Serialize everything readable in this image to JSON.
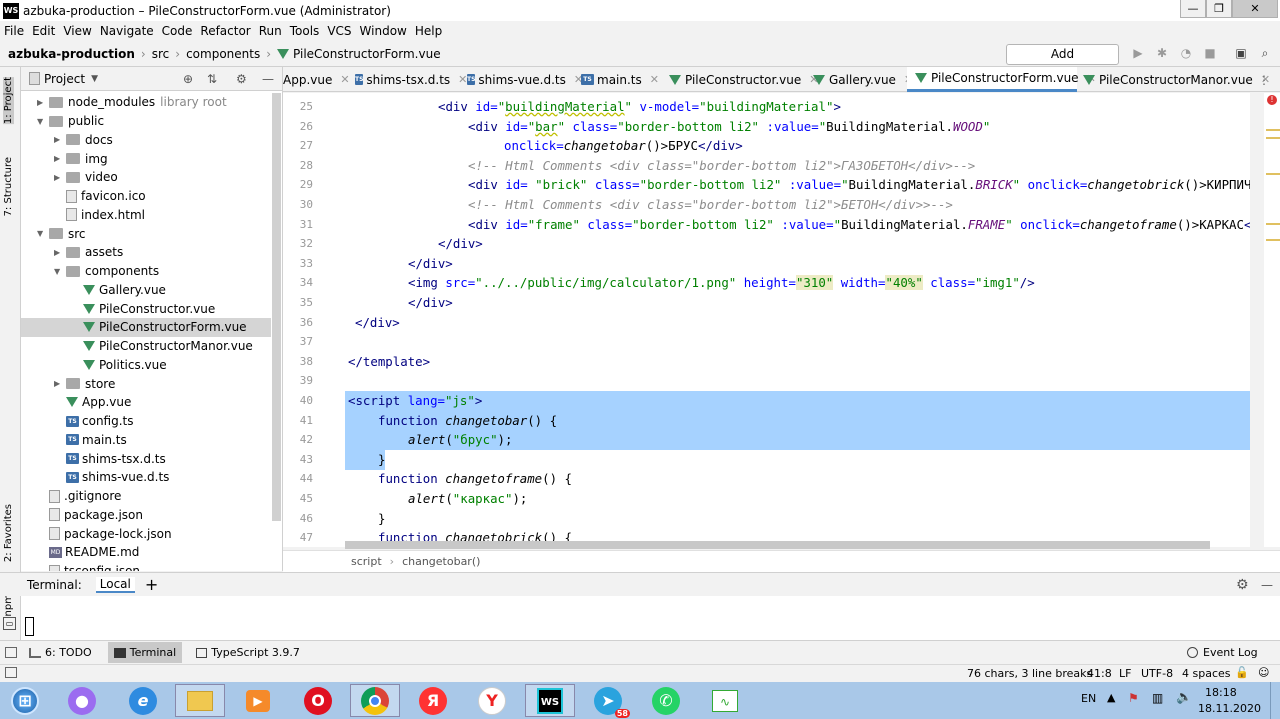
{
  "window": {
    "title": "azbuka-production – PileConstructorForm.vue (Administrator)"
  },
  "menu": [
    "File",
    "Edit",
    "View",
    "Navigate",
    "Code",
    "Refactor",
    "Run",
    "Tools",
    "VCS",
    "Window",
    "Help"
  ],
  "nav": {
    "project": "azbuka-production",
    "p1": "src",
    "p2": "components",
    "file": "PileConstructorForm.vue",
    "add_config": "Add Configuration..."
  },
  "side_labels": {
    "project": "1: Project",
    "structure": "7: Structure",
    "favorites": "2: Favorites",
    "npm": "npm"
  },
  "project_panel": {
    "title": "Project"
  },
  "tree": [
    {
      "label": "node_modules",
      "extra": "library root"
    },
    {
      "label": "public"
    },
    {
      "label": "docs"
    },
    {
      "label": "img"
    },
    {
      "label": "video"
    },
    {
      "label": "favicon.ico"
    },
    {
      "label": "index.html"
    },
    {
      "label": "src"
    },
    {
      "label": "assets"
    },
    {
      "label": "components"
    },
    {
      "label": "Gallery.vue"
    },
    {
      "label": "PileConstructor.vue"
    },
    {
      "label": "PileConstructorForm.vue"
    },
    {
      "label": "PileConstructorManor.vue"
    },
    {
      "label": "Politics.vue"
    },
    {
      "label": "store"
    },
    {
      "label": "App.vue"
    },
    {
      "label": "config.ts"
    },
    {
      "label": "main.ts"
    },
    {
      "label": "shims-tsx.d.ts"
    },
    {
      "label": "shims-vue.d.ts"
    },
    {
      "label": ".gitignore"
    },
    {
      "label": "package.json"
    },
    {
      "label": "package-lock.json"
    },
    {
      "label": "README.md"
    },
    {
      "label": "tsconfig.json"
    }
  ],
  "tabs": [
    "App.vue",
    "shims-tsx.d.ts",
    "shims-vue.d.ts",
    "main.ts",
    "PileConstructor.vue",
    "Gallery.vue",
    "PileConstructorForm.vue",
    "PileConstructorManor.vue"
  ],
  "line_numbers": [
    "25",
    "26",
    "27",
    "28",
    "29",
    "30",
    "31",
    "32",
    "33",
    "34",
    "35",
    "36",
    "37",
    "38",
    "39",
    "40",
    "41",
    "42",
    "43",
    "44",
    "45",
    "46",
    "47"
  ],
  "code": {
    "l25": "<div id=\"buildingMaterial\" v-model=\"buildingMaterial\">",
    "l26": "<div id=\"bar\" class=\"border-bottom li2\" :value=\"BuildingMaterial.WOOD\"",
    "l27": "onclick=changetobar()>БРУС</div>",
    "l28": "<!-- Html Comments <div class=\"border-bottom li2\">ГАЗОБЕТОН</div>-->",
    "l29": "<div id= \"brick\" class=\"border-bottom li2\" :value=\"BuildingMaterial.BRICK\" onclick=changetobrick()>КИРПИЧ</d",
    "l30": "<!-- Html Comments <div class=\"border-bottom li2\">БЕТОН</div>>-->",
    "l31": "<div id=\"frame\" class=\"border-bottom li2\" :value=\"BuildingMaterial.FRAME\" onclick=changetoframe()>КАРКАС</di",
    "l32": "</div>",
    "l33": "</div>",
    "l34": "<img src=\"../../public/img/calculator/1.png\" height=\"310\" width=\"40%\" class=\"img1\"/>",
    "l35": "</div>",
    "l36": "</div>",
    "l37": "",
    "l38": "</template>",
    "l39": "",
    "l40": "<script lang=\"js\">",
    "l41": "function changetobar() {",
    "l42": "alert(\"брус\");",
    "l43": "}",
    "l44": "function changetoframe() {",
    "l45": "alert(\"каркас\");",
    "l46": "}",
    "l47": "function changetobrick() {"
  },
  "breadcrumb": {
    "a": "script",
    "b": "changetobar()"
  },
  "terminal": {
    "label": "Terminal:",
    "tab": "Local",
    "add": "+"
  },
  "bottom_tabs": {
    "todo": "6: TODO",
    "terminal": "Terminal",
    "ts": "TypeScript 3.9.7",
    "event_log": "Event Log"
  },
  "status": {
    "chars": "76 chars, 3 line breaks",
    "pos": "41:8",
    "lf": "LF",
    "enc": "UTF-8",
    "indent": "4 spaces"
  },
  "taskbar": {
    "lang": "EN",
    "time": "18:18",
    "date": "18.11.2020",
    "tg_badge": "58"
  }
}
